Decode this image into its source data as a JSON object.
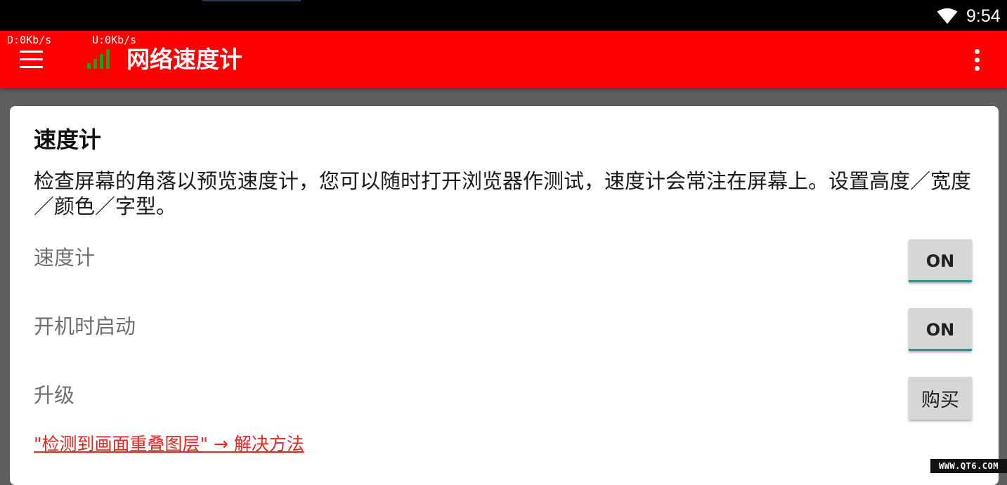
{
  "status_bar": {
    "time": "9:54",
    "wifi_icon": "wifi-icon"
  },
  "app_bar": {
    "download_speed": "D:0Kb/s",
    "upload_speed": "U:0Kb/s",
    "title": "网络速度计",
    "menu_icon": "hamburger-menu-icon",
    "signal_icon": "signal-bars-icon",
    "overflow_icon": "more-vertical-icon",
    "color": "#ff0000"
  },
  "card": {
    "title": "速度计",
    "description": "检查屏幕的角落以预览速度计，您可以随时打开浏览器作测试，速度计会常注在屏幕上。设置高度／宽度／颜色／字型。",
    "settings": [
      {
        "label": "速度计",
        "button": "ON"
      },
      {
        "label": "开机时启动",
        "button": "ON"
      },
      {
        "label": "升级",
        "button": "购买"
      }
    ],
    "link": "\"检测到画面重叠图层\" → 解决方法"
  },
  "watermark": "WWW.QT6.COM"
}
